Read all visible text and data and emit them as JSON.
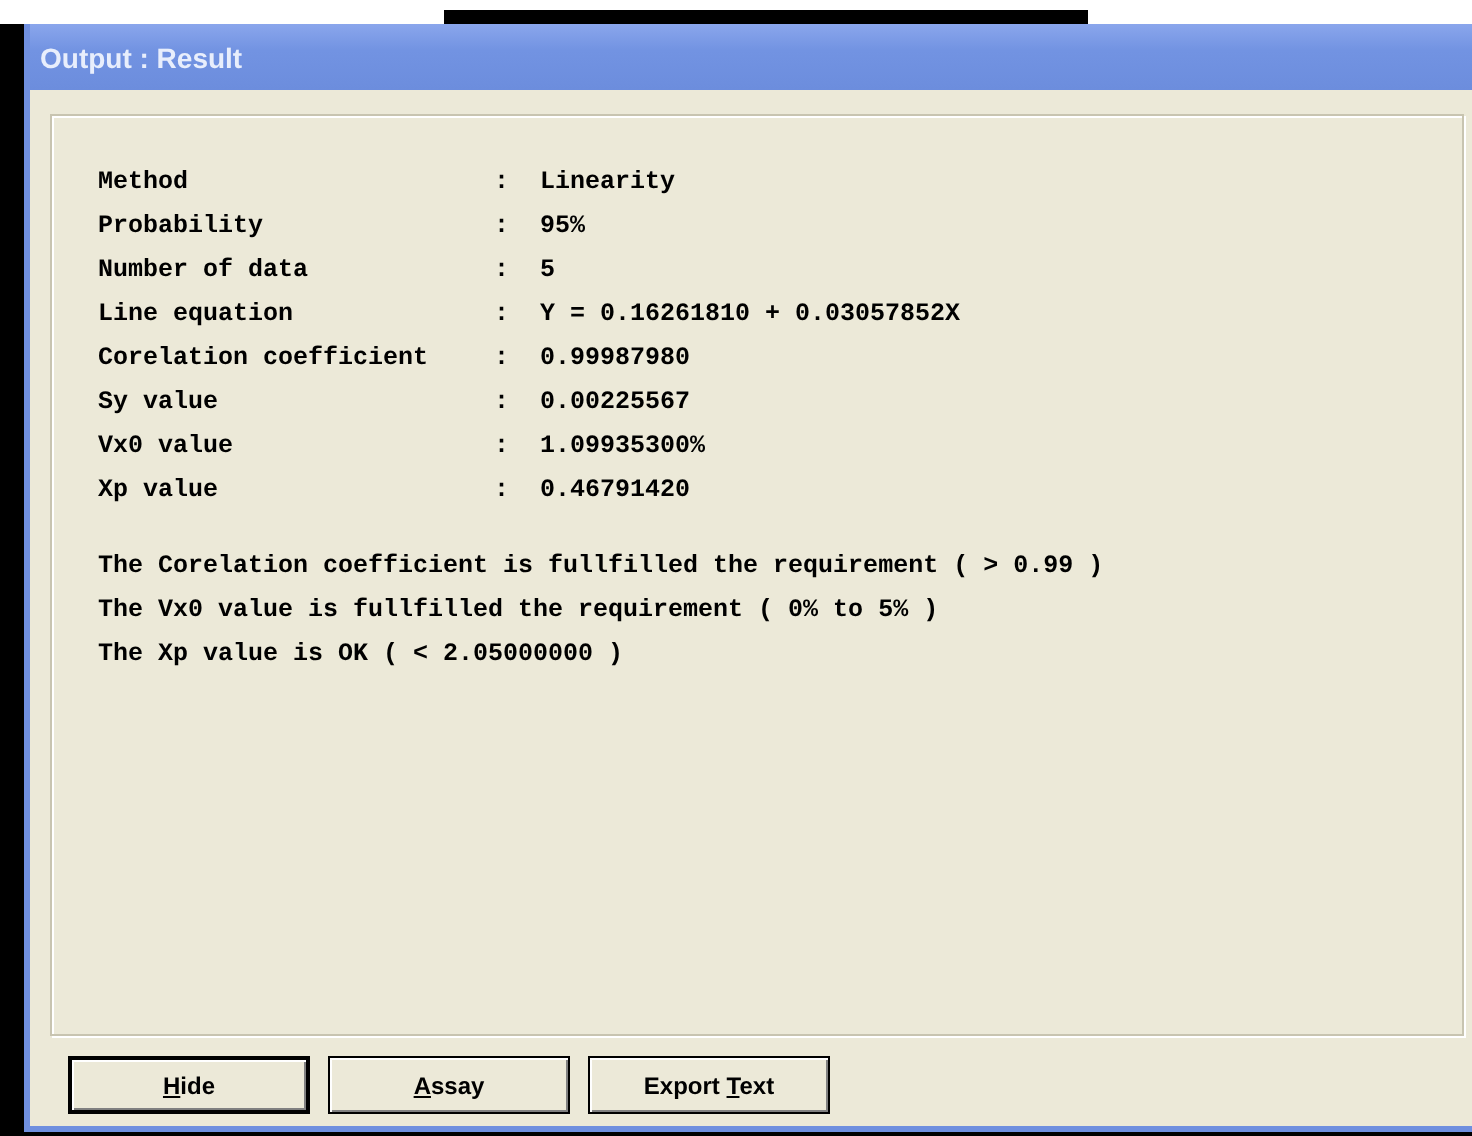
{
  "window": {
    "title": "Output : Result"
  },
  "results": [
    {
      "label": "Method",
      "separator": ":",
      "value": "Linearity"
    },
    {
      "label": "Probability",
      "separator": ":",
      "value": "95%"
    },
    {
      "label": "Number of data",
      "separator": ":",
      "value": "5"
    },
    {
      "label": "Line equation",
      "separator": ":",
      "value": "Y = 0.16261810 + 0.03057852X"
    },
    {
      "label": "Corelation coefficient",
      "separator": ":",
      "value": "0.99987980"
    },
    {
      "label": "Sy value",
      "separator": ":",
      "value": "0.00225567"
    },
    {
      "label": "Vx0 value",
      "separator": ":",
      "value": "1.09935300%"
    },
    {
      "label": "Xp value",
      "separator": ":",
      "value": "0.46791420"
    }
  ],
  "conclusions": [
    "The Corelation coefficient is fullfilled the requirement ( > 0.99 )",
    "The Vx0 value is fullfilled the requirement ( 0% to 5% )",
    "The Xp value is OK ( < 2.05000000 )"
  ],
  "buttons": [
    {
      "label": {
        "hotkey": "H",
        "rest": "ide"
      },
      "default": true
    },
    {
      "label": {
        "hotkey": "A",
        "rest": "ssay"
      },
      "default": false
    },
    {
      "label": {
        "lead": "Export ",
        "hotkey": "T",
        "rest": "ext"
      },
      "default": false
    }
  ]
}
